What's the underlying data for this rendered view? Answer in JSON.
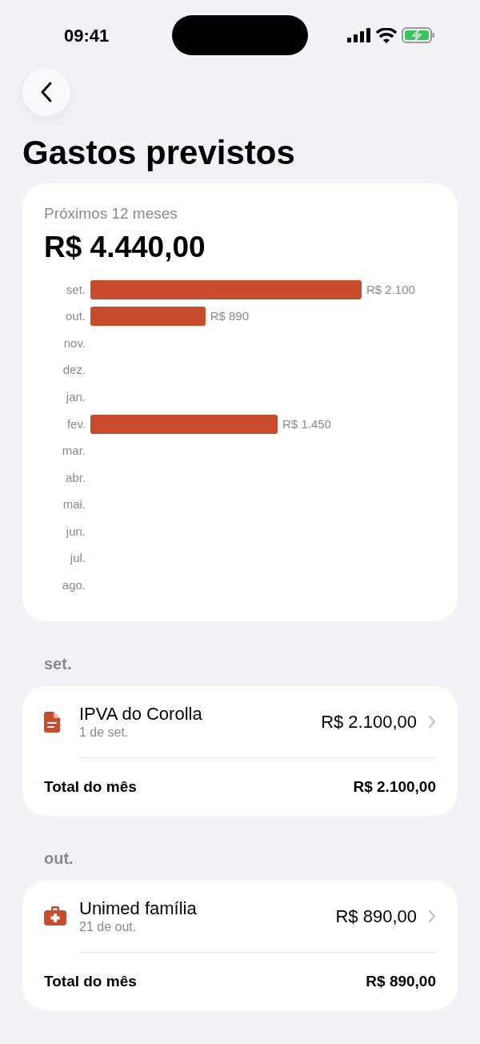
{
  "status_bar": {
    "time": "09:41"
  },
  "title": "Gastos previstos",
  "summary": {
    "label": "Próximos 12 meses",
    "total": "R$ 4.440,00",
    "chart_data": {
      "type": "bar",
      "orientation": "horizontal",
      "categories": [
        "set.",
        "out.",
        "nov.",
        "dez.",
        "jan.",
        "fev.",
        "mar.",
        "abr.",
        "mai.",
        "jun.",
        "jul.",
        "ago."
      ],
      "values": [
        2100,
        890,
        null,
        null,
        null,
        1450,
        null,
        null,
        null,
        null,
        null,
        null
      ],
      "value_labels": [
        "R$ 2.100",
        "R$ 890",
        null,
        null,
        null,
        "R$ 1.450",
        null,
        null,
        null,
        null,
        null,
        null
      ]
    }
  },
  "months": [
    {
      "heading": "set.",
      "items": [
        {
          "kind": "document",
          "name": "IPVA do Corolla",
          "date": "1 de set.",
          "amount": "R$ 2.100,00"
        }
      ],
      "total_label": "Total do mês",
      "total": "R$ 2.100,00"
    },
    {
      "heading": "out.",
      "items": [
        {
          "kind": "medkit",
          "name": "Unimed família",
          "date": "21 de out.",
          "amount": "R$ 890,00"
        }
      ],
      "total_label": "Total do mês",
      "total": "R$ 890,00"
    }
  ]
}
